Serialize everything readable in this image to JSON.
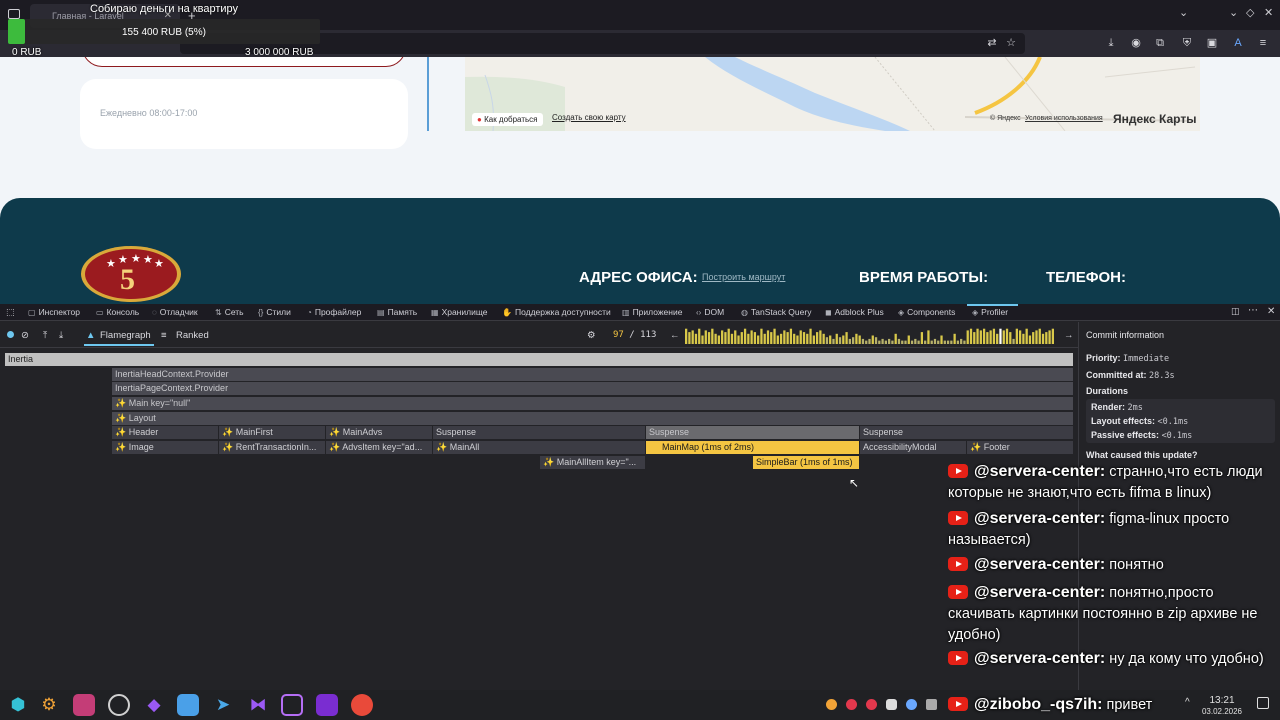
{
  "browser": {
    "tab_title": "Главная - Laravel",
    "tab_close": "✕",
    "new_tab": "+"
  },
  "goal": {
    "title": "Собираю деньги на квартиру",
    "amount": "155 400 RUB (5%)",
    "progress_percent": 5,
    "min": "0 RUB",
    "max": "3 000 000 RUB",
    "fill_color": "#3dbb3d"
  },
  "page": {
    "hours": "Ежедневно 08:00-17:00",
    "map_route_link": "Как добраться",
    "map_create_link": "Создать свою карту",
    "map_copyright": "© Яндекс",
    "map_terms": "Условия использования",
    "map_logo": "Яндекс Карты",
    "address_heading": "АДРЕС ОФИСА:",
    "build_route": "Построить маршрут",
    "hours_heading": "ВРЕМЯ РАБОТЫ:",
    "phone_heading": "ТЕЛЕФОН:",
    "logo_number": "5"
  },
  "devtools": {
    "tabs": [
      {
        "label": "Инспектор",
        "icon": "inspector-icon"
      },
      {
        "label": "Консоль",
        "icon": "console-icon"
      },
      {
        "label": "Отладчик",
        "icon": "debugger-icon"
      },
      {
        "label": "Сеть",
        "icon": "network-icon"
      },
      {
        "label": "Стили",
        "icon": "styles-icon"
      },
      {
        "label": "Профайлер",
        "icon": "profiler-icon"
      },
      {
        "label": "Память",
        "icon": "memory-icon"
      },
      {
        "label": "Хранилище",
        "icon": "storage-icon"
      },
      {
        "label": "Поддержка доступности",
        "icon": "accessibility-icon"
      },
      {
        "label": "Приложение",
        "icon": "application-icon"
      },
      {
        "label": "DOM",
        "icon": "dom-icon"
      },
      {
        "label": "TanStack Query",
        "icon": "tanstack-icon"
      },
      {
        "label": "Adblock Plus",
        "icon": "adblock-icon"
      },
      {
        "label": "Components",
        "icon": "react-components-icon"
      },
      {
        "label": "Profiler",
        "icon": "react-profiler-icon"
      }
    ],
    "active_tab": "Profiler",
    "profiler": {
      "flamegraph_label": "Flamegraph",
      "ranked_label": "Ranked",
      "commit_index": "97",
      "commit_separator": "/",
      "commit_total": "113",
      "prev_arrow": "←",
      "next_arrow": "→"
    },
    "flamegraph": {
      "inertia": "Inertia",
      "head_provider": "InertiaHeadContext.Provider",
      "page_provider": "InertiaPageContext.Provider",
      "main": "✨ Main key=\"null\"",
      "layout": "✨ Layout",
      "header": "✨ Header",
      "main_first": "✨ MainFirst",
      "main_advs": "✨ MainAdvs",
      "suspense_1": "Suspense",
      "suspense_2": "Suspense",
      "suspense_3": "Suspense",
      "image": "✨ Image",
      "rent_transaction": "✨ RentTransactionIn...",
      "advs_item": "✨ AdvsItem key=\"ad...",
      "main_all": "✨ MainAll",
      "main_map": "MainMap (1ms of 2ms)",
      "accessibility_modal": "AccessibilityModal",
      "footer": "✨ Footer",
      "main_all_item": "✨ MainAllItem key=\"...",
      "simple_bar": "SimpleBar (1ms of 1ms)"
    },
    "commit_info": {
      "title": "Commit information",
      "priority_label": "Priority:",
      "priority_value": "Immediate",
      "committed_label": "Committed at:",
      "committed_value": "28.3s",
      "durations_label": "Durations",
      "render_label": "Render:",
      "render_value": "2ms",
      "layout_label": "Layout effects:",
      "layout_value": "<0.1ms",
      "passive_label": "Passive effects:",
      "passive_value": "<0.1ms",
      "cause_label": "What caused this update?"
    }
  },
  "chat": [
    {
      "user": "@servera-center:",
      "text": "странно,что есть люди которые не знают,что есть fifma в linux)"
    },
    {
      "user": "@servera-center:",
      "text": "figma-linux просто называется)"
    },
    {
      "user": "@servera-center:",
      "text": "понятно"
    },
    {
      "user": "@servera-center:",
      "text": "понятно,просто скачивать картинки постоянно в zip архиве не удобно)"
    },
    {
      "user": "@servera-center:",
      "text": "ну да кому что удобно)"
    },
    {
      "user": "@zibobo_-qs7ih:",
      "text": "привет"
    }
  ],
  "taskbar": {
    "time": "13:21",
    "date": "03.02.2026"
  },
  "commit_bars": [
    0.9,
    0.7,
    0.8,
    0.6,
    0.9,
    0.5,
    0.8,
    0.7,
    0.9,
    0.6,
    0.5,
    0.8,
    0.7,
    0.9,
    0.6,
    0.8,
    0.5,
    0.7,
    0.9,
    0.6,
    0.8,
    0.7,
    0.5,
    0.9,
    0.6,
    0.8,
    0.7,
    0.9,
    0.5,
    0.6,
    0.8,
    0.7,
    0.9,
    0.6,
    0.5,
    0.8,
    0.7,
    0.6,
    0.9,
    0.5,
    0.7,
    0.8,
    0.6,
    0.4,
    0.5,
    0.3,
    0.6,
    0.4,
    0.5,
    0.7,
    0.3,
    0.4,
    0.6,
    0.5,
    0.3,
    0.2,
    0.3,
    0.5,
    0.4,
    0.2,
    0.3,
    0.2,
    0.3,
    0.2,
    0.6,
    0.3,
    0.2,
    0.2,
    0.5,
    0.2,
    0.3,
    0.2,
    0.7,
    0.2,
    0.8,
    0.2,
    0.3,
    0.2,
    0.5,
    0.2,
    0.2,
    0.2,
    0.6,
    0.2,
    0.3,
    0.2,
    0.8,
    0.9,
    0.7,
    0.9,
    0.8,
    0.9,
    0.7,
    0.8,
    0.9,
    0.6,
    0.9,
    0.8,
    0.9,
    0.7,
    0.3,
    0.9,
    0.8,
    0.6,
    0.9,
    0.5,
    0.7,
    0.8,
    0.9,
    0.6,
    0.7,
    0.8,
    0.9
  ]
}
